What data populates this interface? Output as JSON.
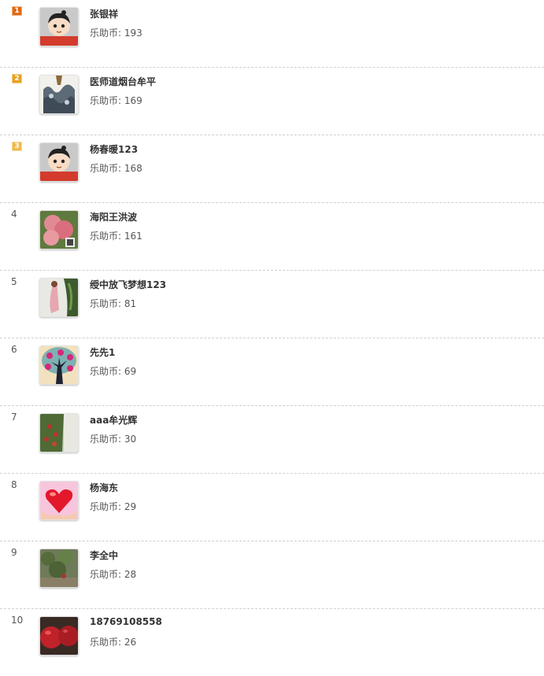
{
  "coin_label": "乐助币: ",
  "rows": [
    {
      "rank": "1",
      "name": "张银祥",
      "coins": "193",
      "avatar": "cartoon-boy-avatar"
    },
    {
      "rank": "2",
      "name": "医师道烟台牟平",
      "coins": "169",
      "avatar": "blue-white-vase-avatar"
    },
    {
      "rank": "3",
      "name": "杨春暖123",
      "coins": "168",
      "avatar": "cartoon-boy-avatar"
    },
    {
      "rank": "4",
      "name": "海阳王洪波",
      "coins": "161",
      "avatar": "peach-fruit-avatar"
    },
    {
      "rank": "5",
      "name": "绶中放飞梦想123",
      "coins": "81",
      "avatar": "person-garden-avatar"
    },
    {
      "rank": "6",
      "name": "先先1",
      "coins": "69",
      "avatar": "apple-tree-drawing-avatar"
    },
    {
      "rank": "7",
      "name": "aaa牟光辉",
      "coins": "30",
      "avatar": "fruit-tree-photo-avatar"
    },
    {
      "rank": "8",
      "name": "杨海东",
      "coins": "29",
      "avatar": "heart-hands-avatar"
    },
    {
      "rank": "9",
      "name": "李全中",
      "coins": "28",
      "avatar": "orchard-photo-avatar"
    },
    {
      "rank": "10",
      "name": "18769108558",
      "coins": "26",
      "avatar": "red-apples-avatar"
    }
  ],
  "colors": {
    "gold": "#e06b12",
    "silver": "#e9a11f",
    "bronze": "#f0b94b",
    "divider": "#cfcfcf"
  }
}
